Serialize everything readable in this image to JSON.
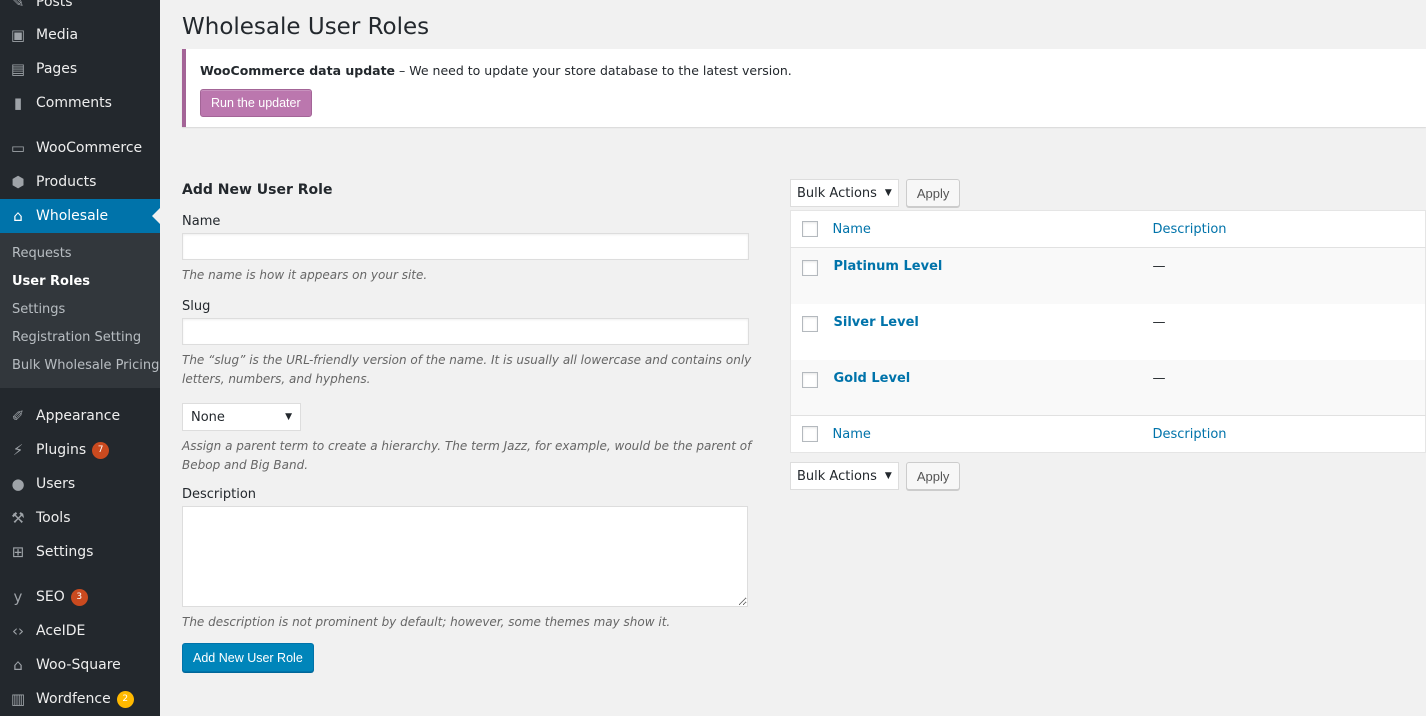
{
  "sidebar": {
    "items": [
      {
        "label": "Posts",
        "icon": "pin-icon"
      },
      {
        "label": "Media",
        "icon": "media-icon"
      },
      {
        "label": "Pages",
        "icon": "pages-icon"
      },
      {
        "label": "Comments",
        "icon": "comment-icon"
      },
      {
        "label": "WooCommerce",
        "icon": "woo-icon"
      },
      {
        "label": "Products",
        "icon": "box-icon"
      },
      {
        "label": "Wholesale",
        "icon": "store-icon"
      },
      {
        "label": "Appearance",
        "icon": "brush-icon"
      },
      {
        "label": "Plugins",
        "icon": "plug-icon",
        "badge": "7"
      },
      {
        "label": "Users",
        "icon": "user-icon"
      },
      {
        "label": "Tools",
        "icon": "wrench-icon"
      },
      {
        "label": "Settings",
        "icon": "sliders-icon"
      },
      {
        "label": "SEO",
        "icon": "yoast-icon",
        "badge": "3"
      },
      {
        "label": "AceIDE",
        "icon": "code-icon"
      },
      {
        "label": "Woo-Square",
        "icon": "store-icon"
      },
      {
        "label": "Wordfence",
        "icon": "wordfence-icon",
        "badge": "2"
      }
    ],
    "submenu": [
      "Requests",
      "User Roles",
      "Settings",
      "Registration Setting",
      "Bulk Wholesale Pricing"
    ]
  },
  "page": {
    "title": "Wholesale User Roles"
  },
  "notice": {
    "bold": "WooCommerce data update",
    "text": " – We need to update your store database to the latest version.",
    "button": "Run the updater",
    "accent": "#a46497"
  },
  "form": {
    "heading": "Add New User Role",
    "name_label": "Name",
    "name_hint": "The name is how it appears on your site.",
    "slug_label": "Slug",
    "slug_hint": "The “slug” is the URL-friendly version of the name. It is usually all lowercase and contains only letters, numbers, and hyphens.",
    "parent_value": "None",
    "parent_hint": "Assign a parent term to create a hierarchy. The term Jazz, for example, would be the parent of Bebop and Big Band.",
    "desc_label": "Description",
    "desc_hint": "The description is not prominent by default; however, some themes may show it.",
    "submit": "Add New User Role"
  },
  "table": {
    "bulk": "Bulk Actions",
    "apply": "Apply",
    "col_name": "Name",
    "col_desc": "Description",
    "rows": [
      {
        "name": "Platinum Level",
        "desc": "—"
      },
      {
        "name": "Silver Level",
        "desc": "—"
      },
      {
        "name": "Gold Level",
        "desc": "—"
      }
    ]
  }
}
